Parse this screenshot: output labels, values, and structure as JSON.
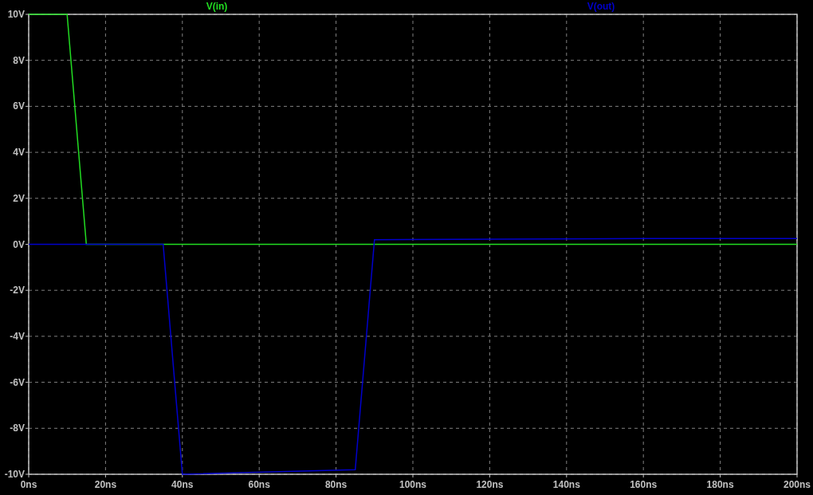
{
  "chart_data": {
    "type": "line",
    "grid": true,
    "x": [
      0,
      10,
      15,
      35,
      40,
      85,
      90,
      160,
      200
    ],
    "xlim": [
      0,
      200
    ],
    "ylim": [
      -10,
      10
    ],
    "xticks": [
      {
        "value": 0,
        "label": "0ns"
      },
      {
        "value": 20,
        "label": "20ns"
      },
      {
        "value": 40,
        "label": "40ns"
      },
      {
        "value": 60,
        "label": "60ns"
      },
      {
        "value": 80,
        "label": "80ns"
      },
      {
        "value": 100,
        "label": "100ns"
      },
      {
        "value": 120,
        "label": "120ns"
      },
      {
        "value": 140,
        "label": "140ns"
      },
      {
        "value": 160,
        "label": "160ns"
      },
      {
        "value": 180,
        "label": "180ns"
      },
      {
        "value": 200,
        "label": "200ns"
      }
    ],
    "yticks": [
      {
        "value": 10,
        "label": "10V"
      },
      {
        "value": 8,
        "label": "8V"
      },
      {
        "value": 6,
        "label": "6V"
      },
      {
        "value": 4,
        "label": "4V"
      },
      {
        "value": 2,
        "label": "2V"
      },
      {
        "value": 0,
        "label": "0V"
      },
      {
        "value": -2,
        "label": "-2V"
      },
      {
        "value": -4,
        "label": "-4V"
      },
      {
        "value": -6,
        "label": "-6V"
      },
      {
        "value": -8,
        "label": "-8V"
      },
      {
        "value": -10,
        "label": "-10V"
      }
    ],
    "series": [
      {
        "name": "V(in)",
        "color": "#22dd22",
        "values": [
          10,
          10,
          0,
          0,
          0,
          0,
          0,
          0,
          0
        ]
      },
      {
        "name": "V(out)",
        "color": "#0000cc",
        "values": [
          0,
          0,
          0,
          0,
          -10,
          -9.8,
          0.2,
          0.25,
          0.25
        ]
      }
    ]
  }
}
